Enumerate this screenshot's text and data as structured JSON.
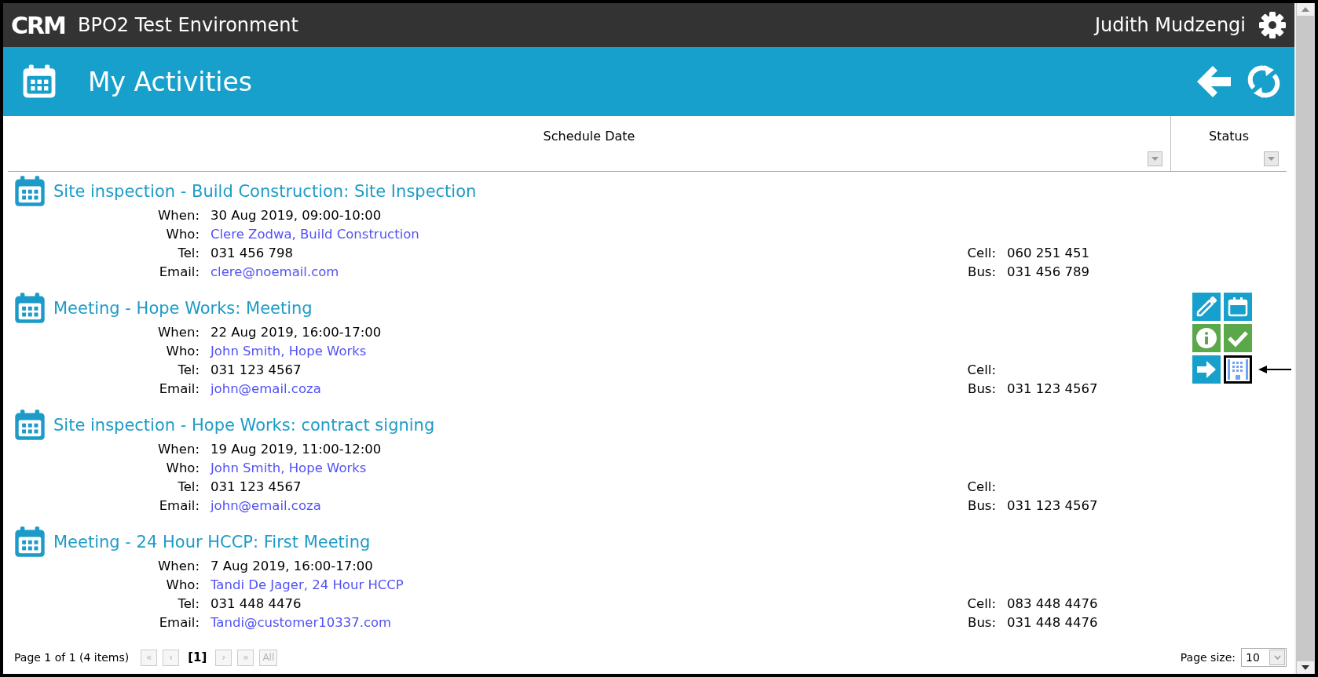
{
  "app": {
    "logo": "CRM",
    "environment": "BPO2 Test Environment",
    "user": "Judith Mudzengi"
  },
  "page": {
    "title": "My Activities"
  },
  "columns": [
    {
      "label": "Schedule Date"
    },
    {
      "label": "Status"
    }
  ],
  "activities": [
    {
      "title": "Site inspection - Build Construction: Site Inspection",
      "fields": [
        {
          "label": "When:",
          "value": "30 Aug 2019, 09:00-10:00",
          "kind": "text"
        },
        {
          "label": "Who:",
          "value": "Clere Zodwa, Build Construction",
          "kind": "link"
        },
        {
          "label": "Tel:",
          "value": "031 456 798",
          "kind": "text"
        },
        {
          "label": "Email:",
          "value": "clere@noemail.com",
          "kind": "link"
        }
      ],
      "side_fields": [
        {
          "label": "Cell:",
          "value": "060 251 451"
        },
        {
          "label": "Bus:",
          "value": "031 456 789"
        }
      ]
    },
    {
      "title": "Meeting - Hope Works: Meeting",
      "fields": [
        {
          "label": "When:",
          "value": "22 Aug 2019, 16:00-17:00",
          "kind": "text"
        },
        {
          "label": "Who:",
          "value": "John Smith, Hope Works",
          "kind": "link"
        },
        {
          "label": "Tel:",
          "value": "031 123 4567",
          "kind": "text"
        },
        {
          "label": "Email:",
          "value": "john@email.coza",
          "kind": "link"
        }
      ],
      "side_fields": [
        {
          "label": "Cell:"
        },
        {
          "label": "Bus:",
          "value": "031 123 4567"
        }
      ],
      "actions": [
        {
          "kind": "edit",
          "highlighted": false
        },
        {
          "kind": "calendar",
          "highlighted": false
        },
        {
          "kind": "info",
          "highlighted": false
        },
        {
          "kind": "complete",
          "highlighted": false
        },
        {
          "kind": "forward",
          "highlighted": false
        },
        {
          "kind": "company",
          "highlighted": true
        }
      ]
    },
    {
      "title": "Site inspection - Hope Works: contract signing",
      "fields": [
        {
          "label": "When:",
          "value": "19 Aug 2019, 11:00-12:00",
          "kind": "text"
        },
        {
          "label": "Who:",
          "value": "John Smith, Hope Works",
          "kind": "link"
        },
        {
          "label": "Tel:",
          "value": "031 123 4567",
          "kind": "text"
        },
        {
          "label": "Email:",
          "value": "john@email.coza",
          "kind": "link"
        }
      ],
      "side_fields": [
        {
          "label": "Cell:"
        },
        {
          "label": "Bus:",
          "value": "031 123 4567"
        }
      ]
    },
    {
      "title": "Meeting - 24 Hour HCCP: First Meeting",
      "fields": [
        {
          "label": "When:",
          "value": "7 Aug 2019, 16:00-17:00",
          "kind": "text"
        },
        {
          "label": "Who:",
          "value": "Tandi De Jager, 24 Hour HCCP",
          "kind": "link"
        },
        {
          "label": "Tel:",
          "value": "031 448 4476",
          "kind": "text"
        },
        {
          "label": "Email:",
          "value": "Tandi@customer10337.com",
          "kind": "link"
        }
      ],
      "side_fields": [
        {
          "label": "Cell:",
          "value": "083 448 4476"
        },
        {
          "label": "Bus:",
          "value": "031 448 4476"
        }
      ]
    }
  ],
  "pager": {
    "summary": "Page 1 of 1 (4 items)",
    "buttons": [
      {
        "label": "«",
        "disabled": true
      },
      {
        "label": "‹",
        "disabled": true
      },
      {
        "label": "[1]",
        "disabled": false,
        "kind": "current"
      },
      {
        "label": "›",
        "disabled": true
      },
      {
        "label": "»",
        "disabled": true
      },
      {
        "label": "All",
        "disabled": true
      }
    ],
    "page_size_label": "Page size:",
    "page_size": "10"
  }
}
